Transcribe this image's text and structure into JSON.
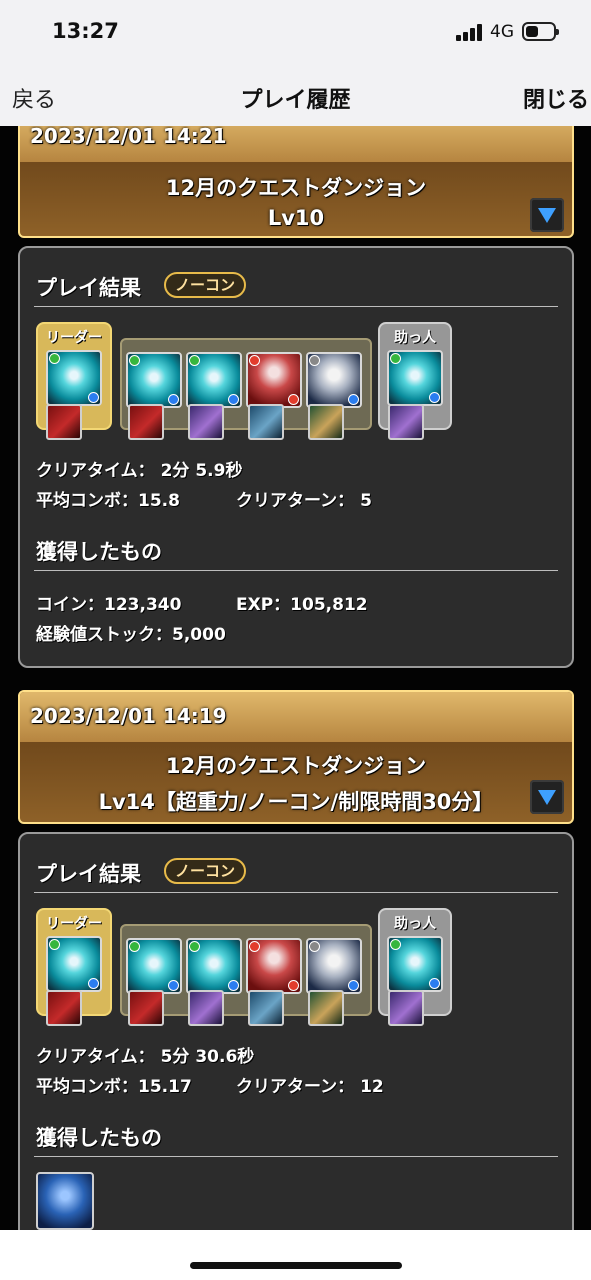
{
  "status_bar": {
    "time": "13:27",
    "network": "4G",
    "battery_level": 0.45
  },
  "nav": {
    "back": "戻る",
    "title": "プレイ履歴",
    "close": "閉じる"
  },
  "entries": [
    {
      "date": "2023/12/01 14:21",
      "dungeon": "12月のクエストダンジョン",
      "level": "Lv10",
      "result_title": "プレイ結果",
      "badge": "ノーコン",
      "leader_label": "リーダー",
      "helper_label": "助っ人",
      "clear_time": "クリアタイム： 2分 5.9秒",
      "avg_combo": "平均コンボ：15.8",
      "clear_turn": "クリアターン： 5",
      "obtained_title": "獲得したもの",
      "coins": "コイン：123,340",
      "exp": "EXP：105,812",
      "exp_stock": "経験値ストック：5,000"
    },
    {
      "date": "2023/12/01 14:19",
      "dungeon": "12月のクエストダンジョン",
      "level": "Lv14【超重力/ノーコン/制限時間30分】",
      "result_title": "プレイ結果",
      "badge": "ノーコン",
      "leader_label": "リーダー",
      "helper_label": "助っ人",
      "clear_time": "クリアタイム： 5分 30.6秒",
      "avg_combo": "平均コンボ：15.17",
      "clear_turn": "クリアターン： 12",
      "obtained_title": "獲得したもの"
    }
  ]
}
